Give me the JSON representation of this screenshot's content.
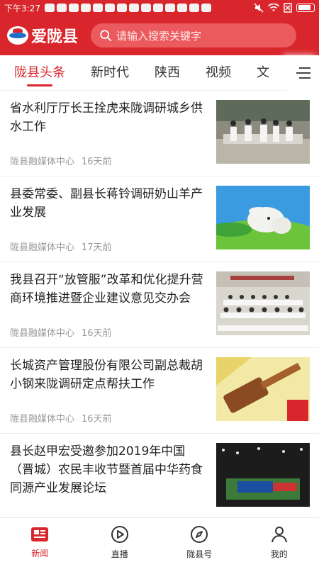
{
  "status_bar": {
    "time": "下午3:27"
  },
  "app": {
    "name": "爱陇县",
    "search_placeholder": "请输入搜索关键字"
  },
  "tabs": [
    {
      "label": "陇县头条",
      "active": true
    },
    {
      "label": "新时代"
    },
    {
      "label": "陕西"
    },
    {
      "label": "视频"
    },
    {
      "label": "文"
    }
  ],
  "news": [
    {
      "title": "省水利厅厅长王拴虎来陇调研城乡供水工作",
      "source": "陇县融媒体中心",
      "time": "16天前"
    },
    {
      "title": "县委常委、副县长蒋铃调研奶山羊产业发展",
      "source": "陇县融媒体中心",
      "time": "17天前"
    },
    {
      "title": "我县召开“放管服”改革和优化提升营商环境推进暨企业建议意见交办会",
      "source": "陇县融媒体中心",
      "time": "16天前"
    },
    {
      "title": "长城资产管理股份有限公司副总裁胡小钢来陇调研定点帮扶工作",
      "source": "陇县融媒体中心",
      "time": "16天前"
    },
    {
      "title": "县长赵甲宏受邀参加2019年中国（晋城）农民丰收节暨首届中华药食同源产业发展论坛",
      "source": "",
      "time": ""
    }
  ],
  "bottom_nav": [
    {
      "label": "新闻",
      "icon": "news-icon",
      "active": true
    },
    {
      "label": "直播",
      "icon": "play-icon"
    },
    {
      "label": "陇县号",
      "icon": "compass-icon"
    },
    {
      "label": "我的",
      "icon": "person-icon"
    }
  ],
  "colors": {
    "brand": "#d9262c",
    "meta_text": "#999999"
  }
}
